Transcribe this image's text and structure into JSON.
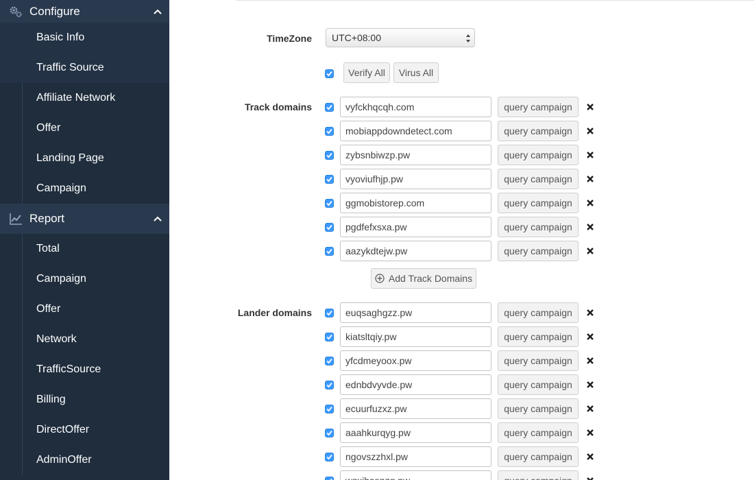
{
  "sidebar": {
    "configure": {
      "label": "Configure",
      "icon": "gear-icon",
      "items": [
        {
          "label": "Basic Info"
        },
        {
          "label": "Traffic Source"
        },
        {
          "label": "Affiliate Network"
        },
        {
          "label": "Offer"
        },
        {
          "label": "Landing Page"
        },
        {
          "label": "Campaign"
        }
      ]
    },
    "report": {
      "label": "Report",
      "icon": "line-chart-icon",
      "items": [
        {
          "label": "Total"
        },
        {
          "label": "Campaign"
        },
        {
          "label": "Offer"
        },
        {
          "label": "Network"
        },
        {
          "label": "TrafficSource"
        },
        {
          "label": "Billing"
        },
        {
          "label": "DirectOffer"
        },
        {
          "label": "AdminOffer"
        }
      ]
    }
  },
  "form": {
    "timezone_label": "TimeZone",
    "timezone_value": "UTC+08:00",
    "verify_all_label": "Verify All",
    "virus_all_label": "Virus All",
    "track_domains_label": "Track domains",
    "lander_domains_label": "Lander domains",
    "query_campaign_label": "query campaign",
    "add_track_domains_label": "Add Track Domains",
    "track_domains": [
      "vyfckhqcqh.com",
      "mobiappdowndetect.com",
      "zybsnbiwzp.pw",
      "vyoviufhjp.pw",
      "ggmobistorep.com",
      "pgdfefxsxa.pw",
      "aazykdtejw.pw"
    ],
    "lander_domains": [
      "euqsaghgzz.pw",
      "kiatsltqiy.pw",
      "yfcdmeyoox.pw",
      "ednbdvyvde.pw",
      "ecuurfuzxz.pw",
      "aaahkurqyg.pw",
      "ngovszzhxl.pw",
      "wsxihsonzg.pw"
    ]
  },
  "colors": {
    "sidebar_bg": "#1f2d3d",
    "sidebar_header_bg": "#2a3a4e",
    "checkbox_blue": "#3b99fc"
  }
}
